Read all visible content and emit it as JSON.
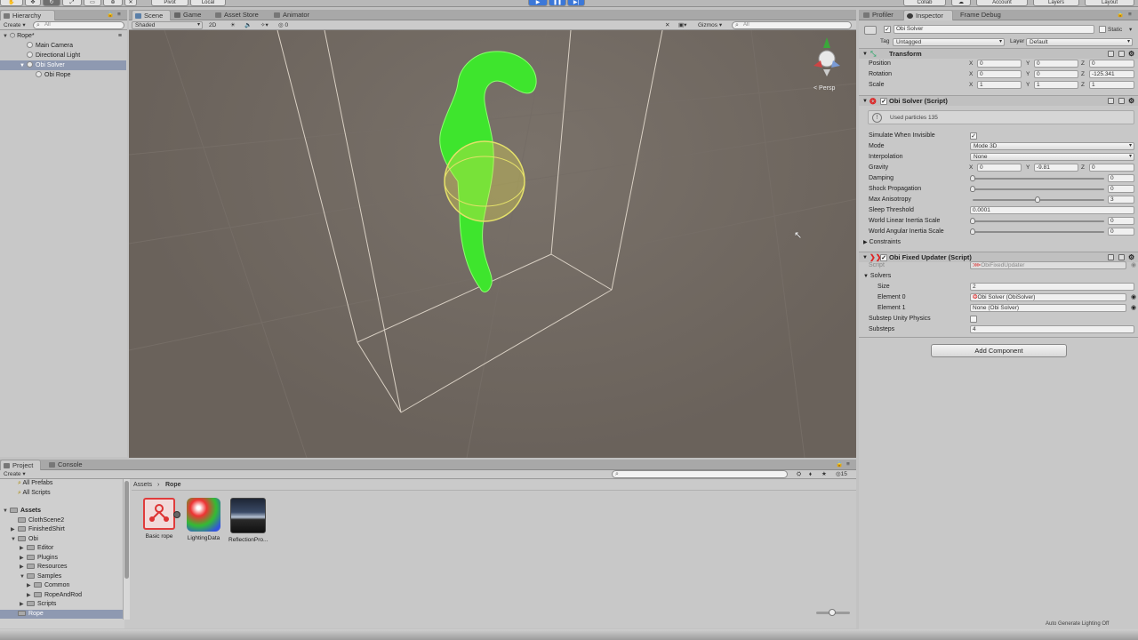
{
  "toolbar": {
    "pivot": "Pivot",
    "local": "Local",
    "collab": "Collab",
    "account": "Account",
    "layers": "Layers",
    "layout": "Layout"
  },
  "hierarchy": {
    "tab": "Hierarchy",
    "create": "Create",
    "search_placeholder": "All",
    "scene": "Rope*",
    "items": [
      "Main Camera",
      "Directional Light",
      "Obi Solver",
      "Obi Rope"
    ]
  },
  "scene": {
    "tabs": [
      "Scene",
      "Game",
      "Asset Store",
      "Animator"
    ],
    "shading": "Shaded",
    "mode2d": "2D",
    "fx_count": "0",
    "gizmos": "Gizmos",
    "search_placeholder": "All",
    "persp": "Persp"
  },
  "inspector": {
    "tabs": [
      "Profiler",
      "Inspector",
      "Frame Debug"
    ],
    "object_name": "Obi Solver",
    "static": "Static",
    "tag_label": "Tag",
    "tag": "Untagged",
    "layer_label": "Layer",
    "layer": "Default",
    "transform": {
      "title": "Transform",
      "rows": [
        {
          "label": "Position",
          "x": "0",
          "y": "0",
          "z": "0"
        },
        {
          "label": "Rotation",
          "x": "0",
          "y": "0",
          "z": "-125.341"
        },
        {
          "label": "Scale",
          "x": "1",
          "y": "1",
          "z": "1"
        }
      ]
    },
    "solver": {
      "title": "Obi Solver (Script)",
      "info": "Used particles 135",
      "simulate_label": "Simulate When Invisible",
      "mode_label": "Mode",
      "mode": "Mode 3D",
      "interp_label": "Interpolation",
      "interp": "None",
      "gravity_label": "Gravity",
      "gravity": {
        "x": "0",
        "y": "-9.81",
        "z": "0"
      },
      "damping_label": "Damping",
      "damping": "0",
      "shock_label": "Shock Propagation",
      "shock": "0",
      "aniso_label": "Max Anisotropy",
      "aniso": "3",
      "sleep_label": "Sleep Threshold",
      "sleep": "0.0001",
      "wlin_label": "World Linear Inertia Scale",
      "wlin": "0",
      "wang_label": "World Angular Inertia Scale",
      "wang": "0",
      "constraints_label": "Constraints"
    },
    "updater": {
      "title": "Obi Fixed Updater (Script)",
      "script_label": "Script",
      "script": "ObiFixedUpdater",
      "solvers_label": "Solvers",
      "size_label": "Size",
      "size": "2",
      "el0_label": "Element 0",
      "el0": "Obi Solver (ObiSolver)",
      "el1_label": "Element 1",
      "el1": "None (Obi Solver)",
      "substep_physics_label": "Substep Unity Physics",
      "substeps_label": "Substeps",
      "substeps": "4"
    },
    "add_component": "Add Component"
  },
  "project": {
    "tabs": [
      "Project",
      "Console"
    ],
    "create": "Create",
    "favorites": [
      "All Prefabs",
      "All Scripts"
    ],
    "tree": [
      {
        "label": "Assets",
        "depth": 0
      },
      {
        "label": "ClothScene2",
        "depth": 1
      },
      {
        "label": "FinishedShirt",
        "depth": 1
      },
      {
        "label": "Obi",
        "depth": 1
      },
      {
        "label": "Editor",
        "depth": 2
      },
      {
        "label": "Plugins",
        "depth": 2
      },
      {
        "label": "Resources",
        "depth": 2
      },
      {
        "label": "Samples",
        "depth": 2
      },
      {
        "label": "Common",
        "depth": 3
      },
      {
        "label": "RopeAndRod",
        "depth": 3
      },
      {
        "label": "Scripts",
        "depth": 2
      },
      {
        "label": "Rope",
        "depth": 1
      }
    ],
    "breadcrumb": [
      "Assets",
      "Rope"
    ],
    "asset_count": "15",
    "assets": [
      "Basic rope",
      "LightingData",
      "ReflectionPro..."
    ]
  },
  "status": {
    "text": "Auto Generate Lighting Off"
  },
  "colors": {
    "rope": "#3ee52d",
    "selection": "#8e99b1",
    "scene_bg": "#6f6760"
  }
}
